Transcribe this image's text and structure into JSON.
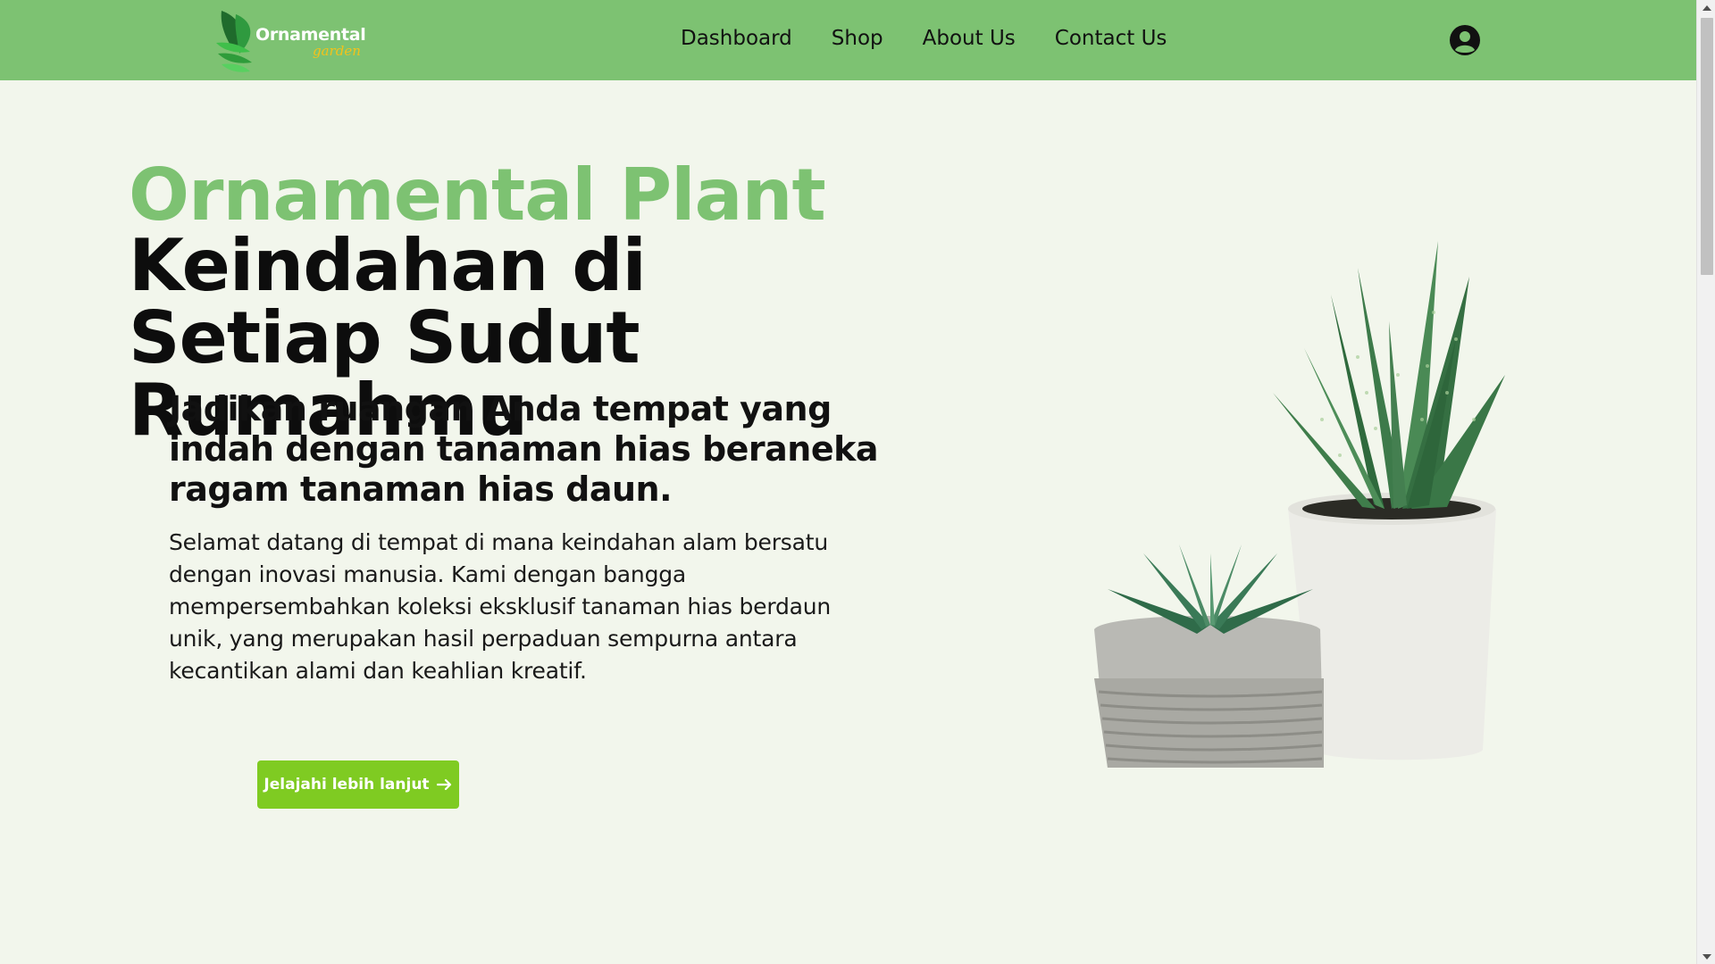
{
  "brand": {
    "title": "Ornamental",
    "subtitle": "garden"
  },
  "nav": {
    "items": [
      {
        "label": "Dashboard"
      },
      {
        "label": "Shop"
      },
      {
        "label": "About Us"
      },
      {
        "label": "Contact Us"
      }
    ],
    "user_icon": "user-circle-icon"
  },
  "hero": {
    "title_green": "Ornamental Plant",
    "title_black": "Keindahan di Setiap Sudut Rumahmu",
    "subtitle": "Jadikan ruangan Anda tempat yang indah dengan tanaman hias beraneka ragam tanaman hias daun.",
    "description": "Selamat datang di tempat di mana keindahan alam bersatu dengan inovasi manusia. Kami dengan bangga mempersembahkan koleksi eksklusif tanaman hias berdaun unik, yang merupakan hasil perpaduan sempurna antara kecantikan alami dan keahlian kreatif.",
    "cta_label": "Jelajahi lebih lanjut",
    "cta_icon": "arrow-right-icon"
  },
  "colors": {
    "navbar": "#7dc272",
    "background": "#f2f6ec",
    "accent_green": "#7dc272",
    "button": "#7fcb22",
    "logo_subtitle": "#f2c21b"
  }
}
